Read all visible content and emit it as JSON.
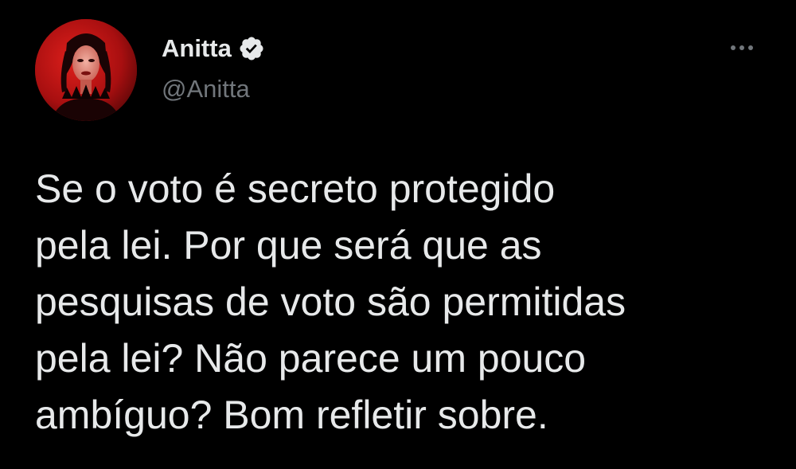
{
  "author": {
    "display_name": "Anitta",
    "handle": "@Anitta",
    "verified": true,
    "avatar_icon": "profile-photo"
  },
  "menu": {
    "icon": "more-horizontal-icon"
  },
  "tweet": {
    "lines": [
      "Se o voto é secreto protegido",
      "pela lei. Por que será que as",
      "pesquisas de voto são permitidas",
      "pela lei? Não parece um pouco",
      "ambíguo? Bom refletir sobre."
    ]
  },
  "colors": {
    "background": "#000000",
    "primary_text": "#e7e9ea",
    "secondary_text": "#71767b",
    "verified_badge": "#e7e9ea"
  }
}
